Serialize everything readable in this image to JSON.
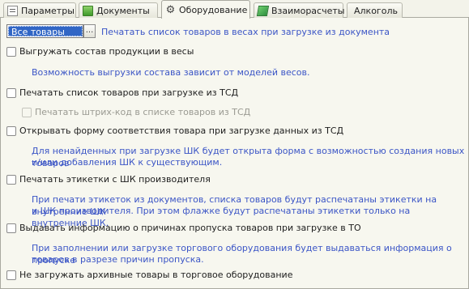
{
  "tabs": [
    {
      "label": "Параметры",
      "icon": "parameters-icon"
    },
    {
      "label": "Документы",
      "icon": "documents-icon"
    },
    {
      "label": "Оборудование",
      "icon": "equipment-icon",
      "active": true
    },
    {
      "label": "Взаиморасчеты",
      "icon": "settlements-icon"
    },
    {
      "label": "Алкоголь",
      "icon": ""
    }
  ],
  "weight_print": {
    "selected_value": "Все товары",
    "button_label": "...",
    "description": "Печатать список товаров в весах при загрузке из документа"
  },
  "options": [
    {
      "label": "Выгружать состав продукции в весы",
      "checked": false,
      "hint": [
        "Возможность выгрузки состава зависит от моделей весов."
      ]
    },
    {
      "label": "Печатать список товаров при загрузке из ТСД",
      "checked": false,
      "hint": []
    },
    {
      "label": "Печатать штрих-код в списке товаров из ТСД",
      "checked": false,
      "disabled": true,
      "hint": []
    },
    {
      "label": "Открывать форму соответствия товара при загрузке данных из ТСД",
      "checked": false,
      "hint": [
        "Для ненайденных при загрузке ШК будет открыта форма с возможностью создания новых товаров",
        "и/или добавления ШК к существующим."
      ]
    },
    {
      "label": "Печатать этикетки с ШК производителя",
      "checked": false,
      "hint": [
        "При печати этикеток из документов, списка товаров будут распечатаны этикетки на внутренние ШК",
        "и ШК производителя. При этом флажке будут распечатаны этикетки только на внутренние ШК."
      ]
    },
    {
      "label": "Выдавать информацию о причинах пропуска товаров при загрузке в ТО",
      "checked": false,
      "hint": [
        "При заполнении или загрузке торгового оборудования будет выдаваться информация о пропуске",
        "товаров в разрезе причин пропуска."
      ]
    },
    {
      "label": "Не загружать архивные товары в торговое оборудование",
      "checked": false,
      "hint": []
    }
  ],
  "colors": {
    "hint_text": "#3b55c6",
    "selection": "#3166c5"
  }
}
